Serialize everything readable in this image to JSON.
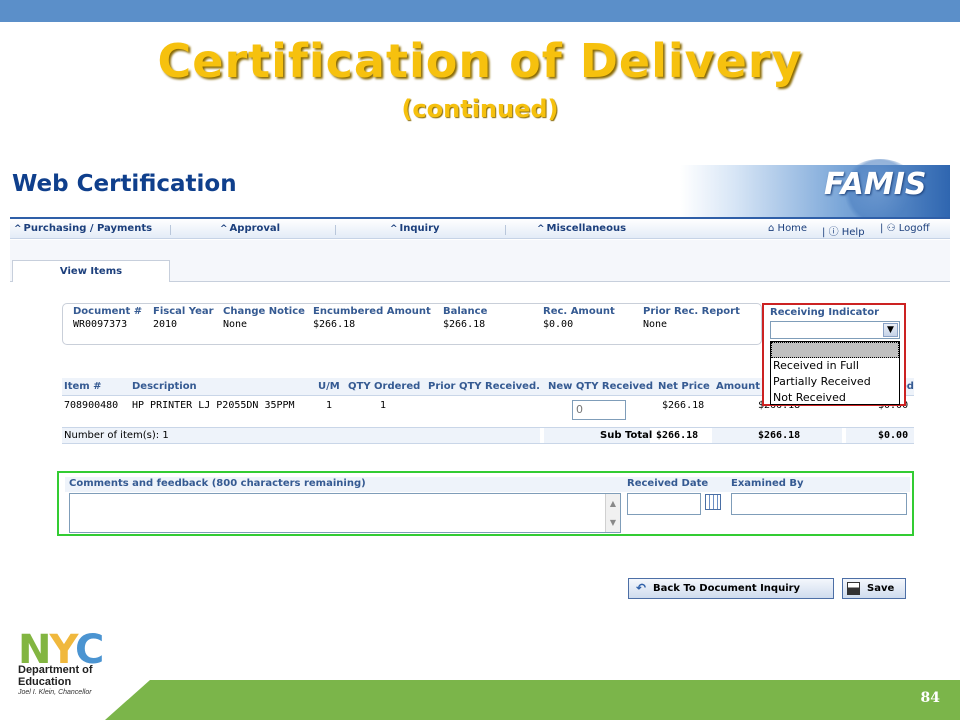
{
  "slide": {
    "title": "Certification of Delivery",
    "subtitle": "(continued)",
    "page_number": "84"
  },
  "app": {
    "title": "Web Certification",
    "logo": "FAMIS",
    "nav": {
      "items": [
        "Purchasing / Payments",
        "Approval",
        "Inquiry",
        "Miscellaneous"
      ],
      "home": "Home",
      "help": "Help",
      "logoff": "Logoff"
    },
    "tab": "View Items"
  },
  "document": {
    "headers": [
      "Document #",
      "Fiscal Year",
      "Change Notice",
      "Encumbered Amount",
      "Balance",
      "Rec. Amount",
      "Prior Rec. Report"
    ],
    "values": [
      "WR0097373",
      "2010",
      "None",
      "$266.18",
      "$266.18",
      "$0.00",
      "None"
    ]
  },
  "receiving": {
    "label": "Receiving Indicator",
    "options": [
      "",
      "Received in Full",
      "Partially Received",
      "Not Received"
    ]
  },
  "items": {
    "headers": [
      "Item #",
      "Description",
      "U/M",
      "QTY Ordered",
      "Prior QTY Received.",
      "New QTY Received",
      "Net Price",
      "Amount"
    ],
    "row": {
      "item": "708900480",
      "description": "HP PRINTER LJ P2055DN 35PPM",
      "um": "1",
      "qty_ordered": "1",
      "new_qty": "0",
      "net_price": "$266.18",
      "amount": "$266.18",
      "received": "$0.00"
    },
    "count_label": "Number of item(s): 1",
    "subtotal_label": "Sub Total",
    "subtotal_net": "$266.18",
    "subtotal_amount": "$266.18",
    "subtotal_received": "$0.00",
    "received_header_fragment": "ed"
  },
  "comments": {
    "label": "Comments and feedback (800 characters remaining)",
    "received_date_label": "Received Date",
    "examined_by_label": "Examined By"
  },
  "buttons": {
    "back": "Back To Document Inquiry",
    "save": "Save"
  },
  "logo": {
    "nyc_n": "N",
    "nyc_y": "Y",
    "nyc_c": "C",
    "dept_line1": "Department of",
    "dept_line2": "Education",
    "chancellor": "Joel I. Klein, Chancellor"
  }
}
